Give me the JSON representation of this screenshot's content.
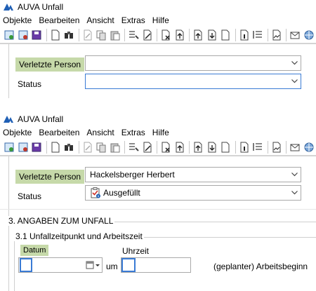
{
  "window1": {
    "title": "AUVA Unfall",
    "menu": [
      "Objekte",
      "Bearbeiten",
      "Ansicht",
      "Extras",
      "Hilfe"
    ],
    "fields": {
      "person_label": "Verletzte Person",
      "person_value": "",
      "status_label": "Status",
      "status_value": ""
    }
  },
  "window2": {
    "title": "AUVA Unfall",
    "menu": [
      "Objekte",
      "Bearbeiten",
      "Ansicht",
      "Extras",
      "Hilfe"
    ],
    "fields": {
      "person_label": "Verletzte Person",
      "person_value": "Hackelsberger Herbert",
      "status_label": "Status",
      "status_value": "Ausgefüllt"
    },
    "section_title": "3. ANGABEN ZUM UNFALL",
    "subsection_title": "3.1 Unfallzeitpunkt und Arbeitszeit",
    "date_label": "Datum",
    "date_value": "",
    "um_label": "um",
    "time_label": "Uhrzeit",
    "time_value": "",
    "arbeitsbeginn_label": "(geplanter) Arbeitsbeginn"
  },
  "toolbar_icons": [
    "new-green-icon",
    "new-red-icon",
    "save-icon",
    "new-doc-icon",
    "binoculars-icon",
    "edit-doc-icon",
    "copy-icon",
    "paste-icon",
    "list-tools-icon",
    "edit-pen-icon",
    "delete-doc-icon",
    "arrow-up-doc-icon",
    "arrow-up2-doc-icon",
    "arrow-down-doc-icon",
    "doc-icon",
    "doc-info-icon",
    "list-sort-icon",
    "sign-doc-icon",
    "mail-doc-icon",
    "globe-icon"
  ],
  "colors": {
    "label_highlight": "#c6d9a9",
    "focus_border": "#3a7bd5",
    "logo_blue": "#1f5fb5"
  }
}
